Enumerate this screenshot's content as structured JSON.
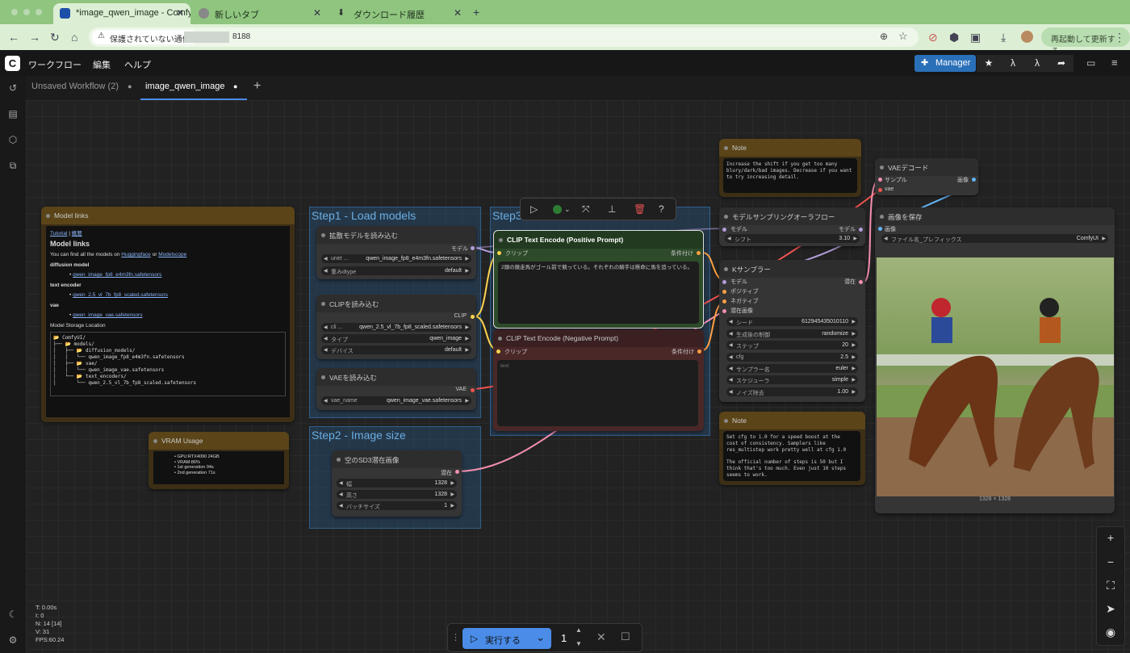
{
  "browser": {
    "tabs": [
      {
        "title": "*image_qwen_image - Comfy"
      },
      {
        "title": "新しいタブ"
      },
      {
        "title": "ダウンロード履歴"
      }
    ],
    "new_tab": "+",
    "security_chip": "保護されていない通信",
    "url": "8188",
    "restart_label": "再起動して更新する"
  },
  "app": {
    "menu": [
      "ワークフロー",
      "編集",
      "ヘルプ"
    ],
    "manager_label": "Manager",
    "workflow_tabs": [
      {
        "label": "Unsaved Workflow (2)",
        "active": false
      },
      {
        "label": "image_qwen_image",
        "active": true
      }
    ]
  },
  "groups": {
    "step1": "Step1 - Load models",
    "step2": "Step2 - Image size",
    "step3": "Step3"
  },
  "model_links": {
    "title": "Model links",
    "tutorial": "Tutorial",
    "sep": "|",
    "overview": "概要",
    "heading": "Model links",
    "intro_a": "You can find all the models on ",
    "hf": "Huggingface",
    "or": " or ",
    "ms": "Modelscope",
    "diffusion_label": "diffusion model",
    "diffusion_file": "qwen_image_fp8_e4m3fn.safetensors",
    "te_label": "text encoder",
    "te_file": "qwen_2.5_vl_7b_fp8_scaled.safetensors",
    "vae_label": "vae",
    "vae_file": "qwen_image_vae.safetensors",
    "storage_label": "Model Storage Location",
    "tree": "📂 ComfyUI/\n├── 📂 models/\n│   ├── 📂 diffusion_models/\n│   │   └── qwen_image_fp8_e4m3fn.safetensors\n│   ├── 📂 vae/\n│   │   └── qwen_image_vae.safetensors\n│   └── 📂 text_encoders/\n│       └── qwen_2.5_vl_7b_fp8_scaled.safetensors"
  },
  "vram": {
    "title": "VRAM Usage",
    "items": [
      "GPU:RTX4090 24GB",
      "VRAM:86%",
      "1st generation 94s",
      "2nd generation 71s"
    ]
  },
  "unet_loader": {
    "title": "拡散モデルを読み込む",
    "out": "モデル",
    "w1_label": "unet ...",
    "w1_value": "qwen_image_fp8_e4m3fn.safetensors",
    "w2_label": "重みdtype",
    "w2_value": "default"
  },
  "clip_loader": {
    "title": "CLIPを読み込む",
    "out": "CLIP",
    "w1_label": "cli ...",
    "w1_value": "qwen_2.5_vl_7b_fp8_scaled.safetensors",
    "w2_label": "タイプ",
    "w2_value": "qwen_image",
    "w3_label": "デバイス",
    "w3_value": "default"
  },
  "vae_loader": {
    "title": "VAEを読み込む",
    "out": "VAE",
    "w1_label": "vae_name",
    "w1_value": "qwen_image_vae.safetensors"
  },
  "latent": {
    "title": "空のSD3潜在画像",
    "out": "潜在",
    "w1_label": "幅",
    "w1_value": "1328",
    "w2_label": "高さ",
    "w2_value": "1328",
    "w3_label": "バッチサイズ",
    "w3_value": "1"
  },
  "pos": {
    "title": "CLIP Text Encode (Positive Prompt)",
    "in": "クリップ",
    "out": "条件付け",
    "text": "2頭の競走馬がゴール前で競っている。それぞれの騎手は懸命に馬を追っている。"
  },
  "neg": {
    "title": "CLIP Text Encode (Negative Prompt)",
    "in": "クリップ",
    "out": "条件付け",
    "placeholder": "text"
  },
  "note1": {
    "title": "Note",
    "text": "Increase the shift if you get too many\nblury/dark/bad images. Decrease if you want\nto try increasing detail."
  },
  "msampling": {
    "title": "モデルサンプリングオーラフロー",
    "in": "モデル",
    "out": "モデル",
    "w1_label": "シフト",
    "w1_value": "3.10"
  },
  "ksampler": {
    "title": "Kサンプラー",
    "inputs": [
      "モデル",
      "ポジティブ",
      "ネガティブ",
      "潜在画像"
    ],
    "out": "潜在",
    "widgets": [
      {
        "label": "シード",
        "value": "612945435010110"
      },
      {
        "label": "生成後の制御",
        "value": "randomize"
      },
      {
        "label": "ステップ",
        "value": "20"
      },
      {
        "label": "cfg",
        "value": "2.5"
      },
      {
        "label": "サンプラー名",
        "value": "euler"
      },
      {
        "label": "スケジューラ",
        "value": "simple"
      },
      {
        "label": "ノイズ除去",
        "value": "1.00"
      }
    ]
  },
  "note2": {
    "title": "Note",
    "text": "Set cfg to 1.0 for a speed boost at the\ncost of consistency. Samplers like\nres_multistep work pretty well at cfg 1.0\n\nThe official number of steps is 50 but I\nthink that's too much. Even just 10 steps\nseems to work."
  },
  "vae_decode": {
    "title": "VAEデコード",
    "in1": "サンプル",
    "in2": "vae",
    "out": "画像"
  },
  "save_image": {
    "title": "画像を保存",
    "in": "画像",
    "w1_label": "ファイル名_プレフィックス",
    "w1_value": "ComfyUI",
    "caption": "1328 × 1328"
  },
  "bottom": {
    "run_label": "実行する",
    "count": "1"
  },
  "stats": [
    "T: 0.00s",
    "I: 0",
    "N: 14 [14]",
    "V: 31",
    "FPS:60.24"
  ],
  "colors": {
    "accent": "#4a8ce8",
    "group": "#2f5f8c",
    "note": "#6b5219",
    "pos": "#2d4a2a",
    "neg": "#4a2828"
  }
}
